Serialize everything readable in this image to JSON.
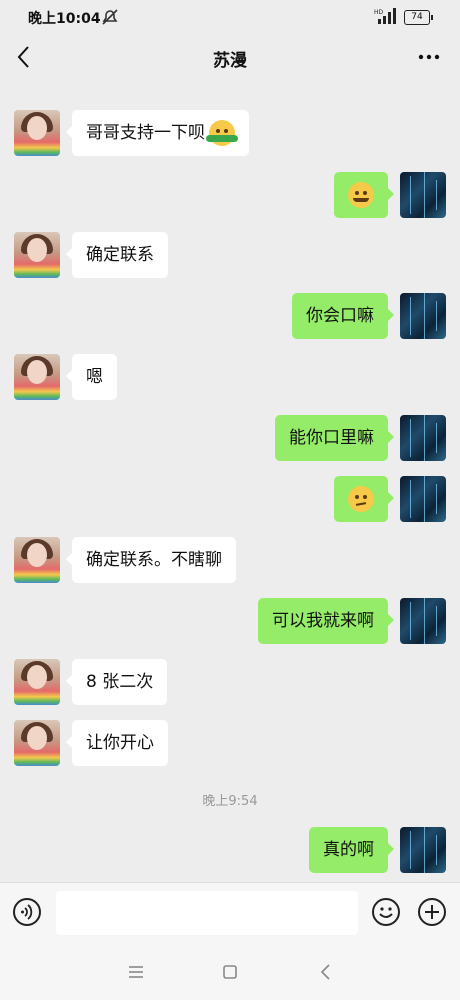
{
  "status": {
    "time": "晚上10:04",
    "battery": "74",
    "signal_label": "HD"
  },
  "header": {
    "title": "苏漫"
  },
  "messages": [
    {
      "side": "left",
      "text": "哥哥支持一下呗",
      "emoji": "hug-emoji"
    },
    {
      "side": "right",
      "text": "",
      "emoji": "laugh-cry-emoji"
    },
    {
      "side": "left",
      "text": "确定联系"
    },
    {
      "side": "right",
      "text": "你会口嘛"
    },
    {
      "side": "left",
      "text": "嗯"
    },
    {
      "side": "right",
      "text": "能你口里嘛"
    },
    {
      "side": "right",
      "text": "",
      "emoji": "thinking-emoji"
    },
    {
      "side": "left",
      "text": "确定联系。不瞎聊"
    },
    {
      "side": "right",
      "text": "可以我就来啊"
    },
    {
      "side": "left",
      "text": "8 张二次"
    },
    {
      "side": "left",
      "text": "让你开心"
    },
    {
      "side": "right",
      "text": "真的啊"
    }
  ],
  "timestamp": "晚上9:54",
  "input": {
    "value": "",
    "placeholder": ""
  },
  "icons": {
    "back": "chevron-left-icon",
    "more": "more-dots-icon",
    "voice": "voice-icon",
    "emoji": "smile-icon",
    "plus": "plus-icon",
    "nav_menu": "menu-icon",
    "nav_home": "home-icon",
    "nav_back": "back-icon"
  },
  "colors": {
    "my_bubble": "#95ec69",
    "their_bubble": "#ffffff",
    "background": "#ededed"
  }
}
